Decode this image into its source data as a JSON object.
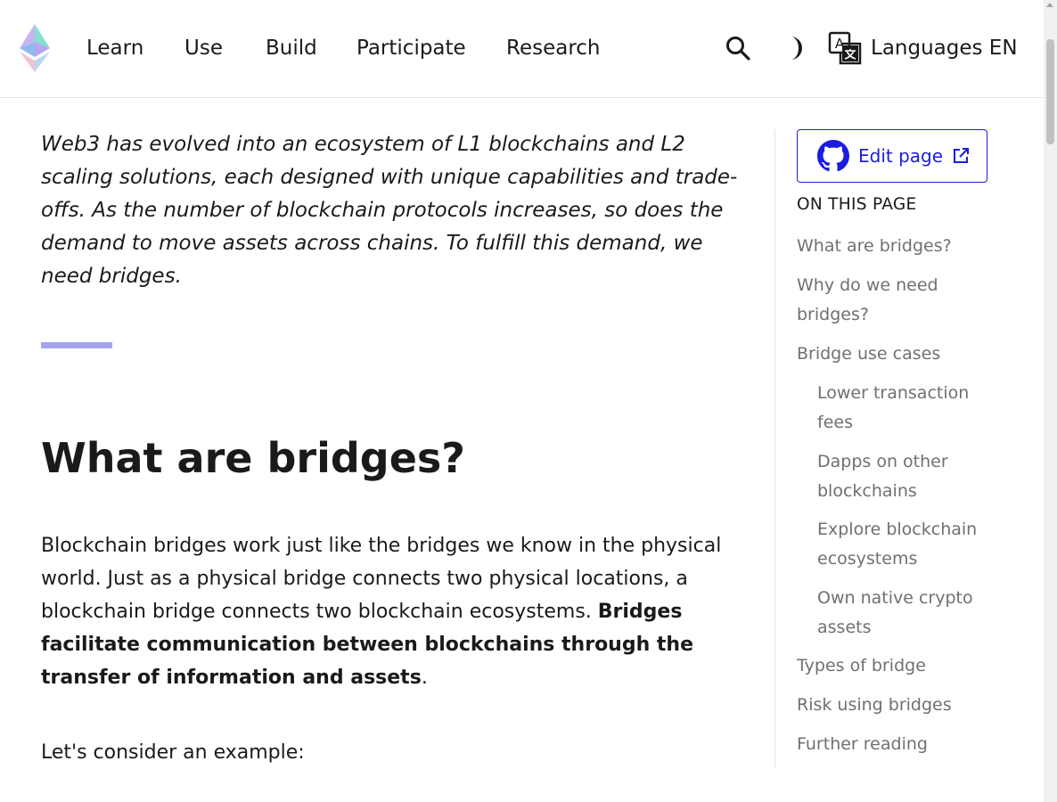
{
  "header": {
    "nav": [
      "Learn",
      "Use",
      "Build",
      "Participate",
      "Research"
    ],
    "languages_label": "Languages EN",
    "icons": {
      "logo": "ethereum-logo",
      "search": "search-icon",
      "theme": "half-moon-icon",
      "language": "translate-icon"
    }
  },
  "main": {
    "intro": "Web3 has evolved into an ecosystem of L1 blockchains and L2 scaling solutions, each designed with unique capabilities and trade-offs. As the number of blockchain protocols increases, so does the demand to move assets across chains. To fulfill this demand, we need bridges.",
    "heading": "What are bridges?",
    "paragraph_text": "Blockchain bridges work just like the bridges we know in the physical world. Just as a physical bridge connects two physical locations, a blockchain bridge connects two blockchain ecosystems. ",
    "paragraph_bold": "Bridges facilitate communication between blockchains through the transfer of information and assets",
    "paragraph_end": ".",
    "paragraph2": "Let's consider an example:"
  },
  "sidebar": {
    "edit_label": "Edit page",
    "toc_title": "ON THIS PAGE",
    "toc": [
      "What are bridges?",
      "Why do we need bridges?",
      "Bridge use cases",
      "Lower transaction fees",
      "Dapps on other blockchains",
      "Explore blockchain ecosystems",
      "Own native crypto assets",
      "Types of bridge",
      "Risk using bridges",
      "Further reading"
    ]
  },
  "colors": {
    "accent": "#1c1ce1",
    "accent_bar": "#a4a4ee",
    "toc_text": "#707070",
    "text": "#1a1a1a"
  }
}
